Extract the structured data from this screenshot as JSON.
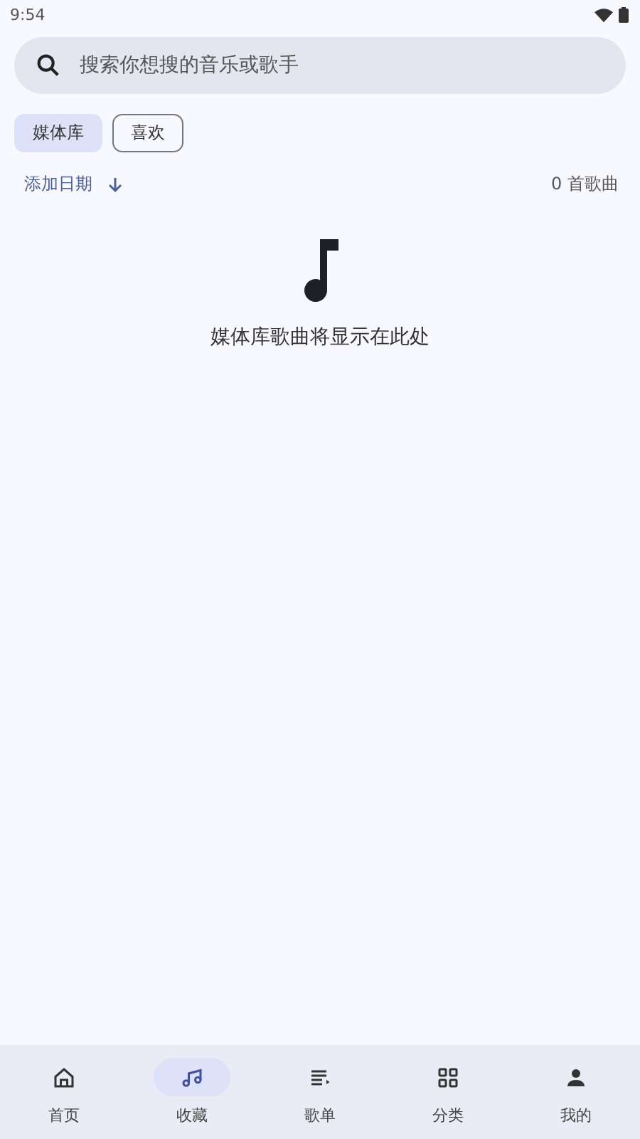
{
  "status_bar": {
    "time": "9:54"
  },
  "search": {
    "placeholder": "搜索你想搜的音乐或歌手"
  },
  "filters": [
    {
      "label": "媒体库",
      "selected": true
    },
    {
      "label": "喜欢",
      "selected": false
    }
  ],
  "sort": {
    "label": "添加日期",
    "count": "0 首歌曲"
  },
  "empty_state": {
    "message": "媒体库歌曲将显示在此处"
  },
  "nav": [
    {
      "label": "首页",
      "kind": "home",
      "selected": false
    },
    {
      "label": "收藏",
      "kind": "music",
      "selected": true
    },
    {
      "label": "歌单",
      "kind": "playlist",
      "selected": false
    },
    {
      "label": "分类",
      "kind": "grid",
      "selected": false
    },
    {
      "label": "我的",
      "kind": "person",
      "selected": false
    }
  ]
}
